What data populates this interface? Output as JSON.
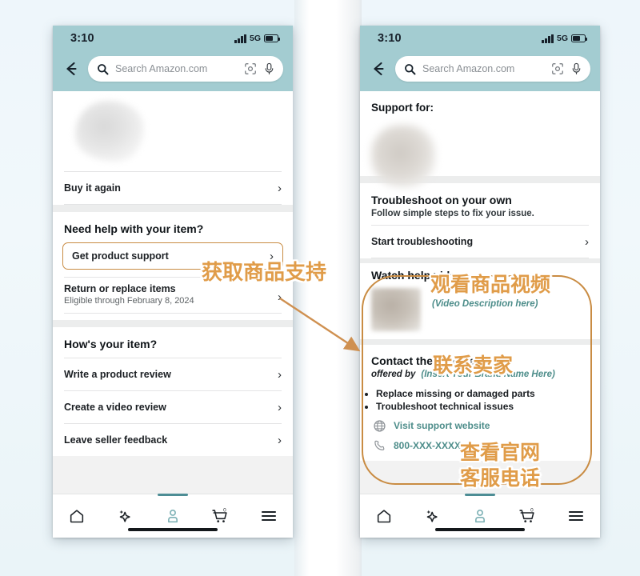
{
  "meta": {
    "accent_orange": "#e09c49",
    "highlight_border": "#c98c43",
    "teal_header": "#a3ccd1",
    "teal_text": "#4d8d8a",
    "page_background": "#eef6fb"
  },
  "status_bar": {
    "time": "3:10",
    "network": "5G",
    "signal_icon": "signal-bars-icon",
    "battery_icon": "battery-icon"
  },
  "search": {
    "back_icon": "back-arrow-icon",
    "search_icon": "search-icon",
    "placeholder": "Search Amazon.com",
    "camera_icon": "camera-scan-icon",
    "mic_icon": "microphone-icon"
  },
  "left_phone": {
    "buy_again": {
      "label": "Buy it again",
      "chevron": "›"
    },
    "need_help": {
      "heading": "Need help with your item?",
      "get_product_support": {
        "label": "Get product support",
        "chevron": "›"
      },
      "return_replace": {
        "label": "Return or replace items",
        "sub": "Eligible through February 8, 2024",
        "chevron": "›"
      }
    },
    "hows_your_item": {
      "heading": "How's your item?",
      "rows": [
        {
          "label": "Write a product review",
          "chevron": "›"
        },
        {
          "label": "Create a video review",
          "chevron": "›"
        },
        {
          "label": "Leave seller feedback",
          "chevron": "›"
        }
      ]
    }
  },
  "right_phone": {
    "support_for": {
      "heading": "Support for:"
    },
    "troubleshoot": {
      "heading": "Troubleshoot on your own",
      "sub": "Follow simple steps to fix your issue.",
      "row": {
        "label": "Start troubleshooting",
        "chevron": "›"
      }
    },
    "watch_videos": {
      "heading": "Watch help videos",
      "thumb": "video-thumbnail",
      "description": "(Video Description here)"
    },
    "contact_manufacturer": {
      "heading": "Contact the manufacturer",
      "offered_by_label": "offered by",
      "brand_placeholder": "(Insert Your Brand Name Here)",
      "bullets": [
        "Replace missing or damaged parts",
        "Troubleshoot technical issues"
      ],
      "website": {
        "icon": "globe-icon",
        "label": "Visit support website"
      },
      "phone": {
        "icon": "phone-icon",
        "label": "800-XXX-XXXX"
      }
    }
  },
  "bottom_nav": {
    "items": [
      {
        "name": "home-icon",
        "label": "Home",
        "active": false
      },
      {
        "name": "rufus-sparkle-icon",
        "label": "Rufus",
        "active": false
      },
      {
        "name": "account-person-icon",
        "label": "Account",
        "active": true
      },
      {
        "name": "cart-icon",
        "label": "Cart",
        "badge": "0",
        "active": false
      },
      {
        "name": "menu-hamburger-icon",
        "label": "Menu",
        "active": false
      }
    ]
  },
  "annotations": {
    "get_support": "获取商品支持",
    "watch_video": "观看商品视频",
    "contact_seller": "联系卖家",
    "visit_website": "查看官网",
    "support_phone": "客服电话"
  }
}
